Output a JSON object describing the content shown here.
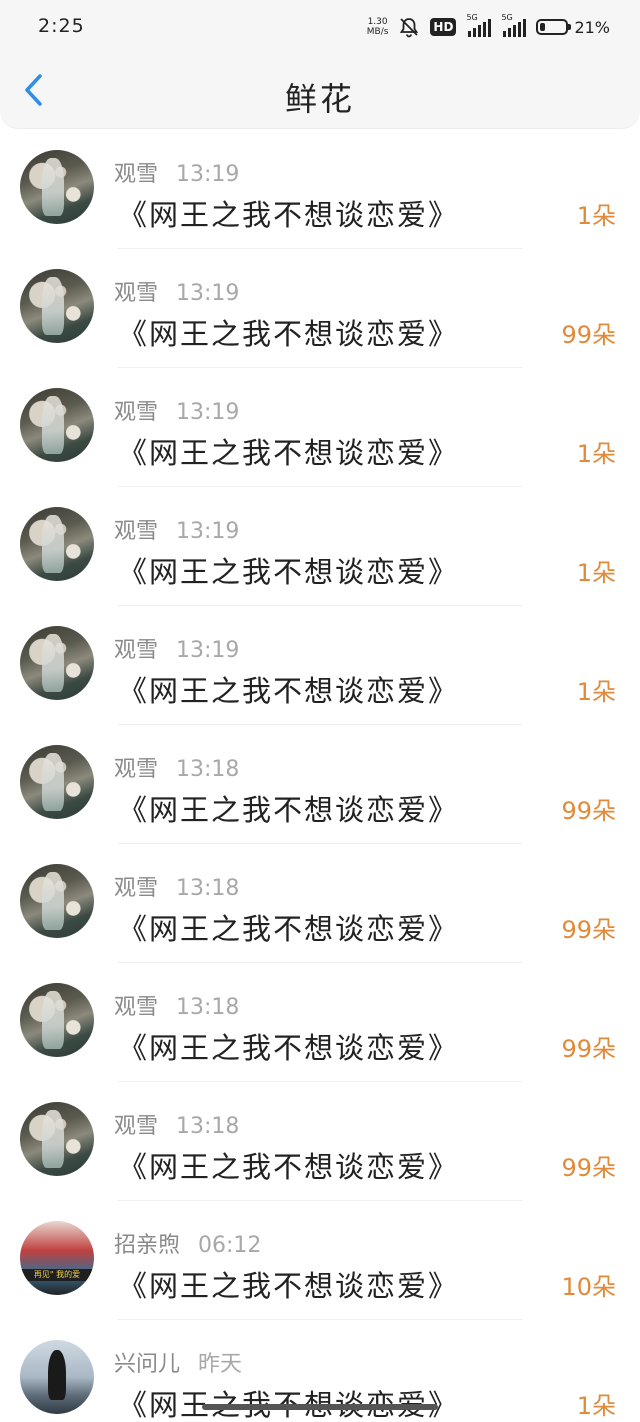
{
  "status_bar": {
    "time": "2:25",
    "net_speed_value": "1.30",
    "net_speed_unit": "MB/s",
    "hd_badge": "HD",
    "sim1_tag": "5G",
    "sim2_tag": "5G",
    "battery_level_percent": 21,
    "battery_text": "21%"
  },
  "header": {
    "title": "鲜花"
  },
  "gifts": [
    {
      "name": "观雪",
      "time": "13:19",
      "book": "《网王之我不想谈恋爱》",
      "amount": "1朵",
      "avatar": "avatar-1"
    },
    {
      "name": "观雪",
      "time": "13:19",
      "book": "《网王之我不想谈恋爱》",
      "amount": "99朵",
      "avatar": "avatar-1"
    },
    {
      "name": "观雪",
      "time": "13:19",
      "book": "《网王之我不想谈恋爱》",
      "amount": "1朵",
      "avatar": "avatar-1"
    },
    {
      "name": "观雪",
      "time": "13:19",
      "book": "《网王之我不想谈恋爱》",
      "amount": "1朵",
      "avatar": "avatar-1"
    },
    {
      "name": "观雪",
      "time": "13:19",
      "book": "《网王之我不想谈恋爱》",
      "amount": "1朵",
      "avatar": "avatar-1"
    },
    {
      "name": "观雪",
      "time": "13:18",
      "book": "《网王之我不想谈恋爱》",
      "amount": "99朵",
      "avatar": "avatar-1"
    },
    {
      "name": "观雪",
      "time": "13:18",
      "book": "《网王之我不想谈恋爱》",
      "amount": "99朵",
      "avatar": "avatar-1"
    },
    {
      "name": "观雪",
      "time": "13:18",
      "book": "《网王之我不想谈恋爱》",
      "amount": "99朵",
      "avatar": "avatar-1"
    },
    {
      "name": "观雪",
      "time": "13:18",
      "book": "《网王之我不想谈恋爱》",
      "amount": "99朵",
      "avatar": "avatar-1"
    },
    {
      "name": "招亲煦",
      "time": "06:12",
      "book": "《网王之我不想谈恋爱》",
      "amount": "10朵",
      "avatar": "avatar-2",
      "avatar_caption": "再见\" 我的爱"
    },
    {
      "name": "兴问儿",
      "time": "昨天",
      "book": "《网王之我不想谈恋爱》",
      "amount": "1朵",
      "avatar": "avatar-3"
    }
  ],
  "colors": {
    "accent_blue": "#2f8fe8",
    "amount_orange": "#e08a3a"
  }
}
